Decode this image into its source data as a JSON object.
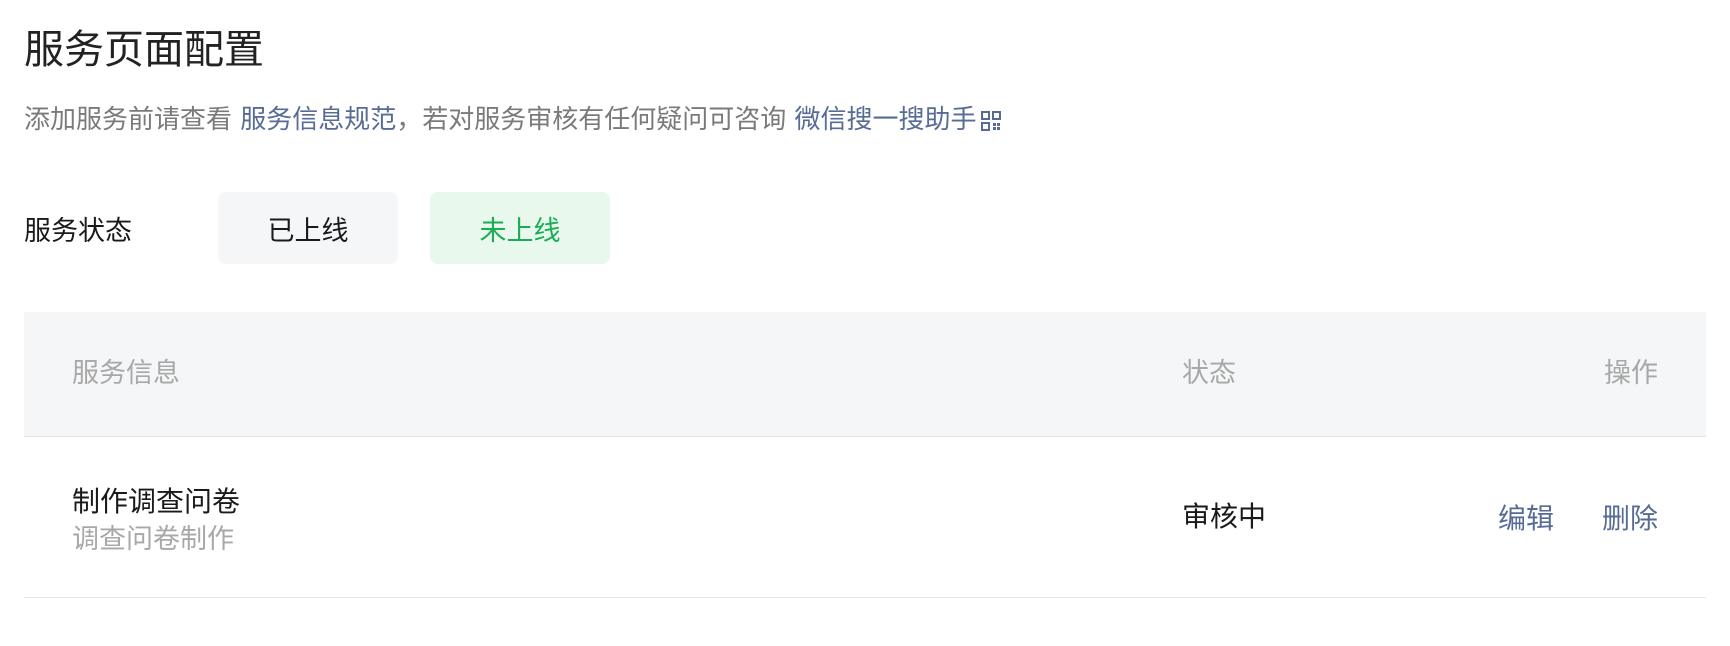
{
  "page": {
    "title": "服务页面配置"
  },
  "subtitle": {
    "prefix": "添加服务前请查看 ",
    "spec_link": "服务信息规范",
    "middle": "，若对服务审核有任何疑问可咨询 ",
    "assistant_link": "微信搜一搜助手",
    "assistant_icon": "qrcode-icon"
  },
  "status_filter": {
    "label": "服务状态",
    "options": [
      {
        "label": "已上线",
        "selected": false
      },
      {
        "label": "未上线",
        "selected": true
      }
    ],
    "active_color": "#1aad55",
    "active_bg": "#e8f8ec"
  },
  "table": {
    "columns": {
      "info": "服务信息",
      "state": "状态",
      "ops": "操作"
    },
    "rows": [
      {
        "name": "制作调查问卷",
        "desc": "调查问卷制作",
        "state": "审核中",
        "edit": "编辑",
        "delete": "删除"
      }
    ]
  },
  "colors": {
    "link": "#576b95",
    "header_bg": "#f5f6f7"
  }
}
